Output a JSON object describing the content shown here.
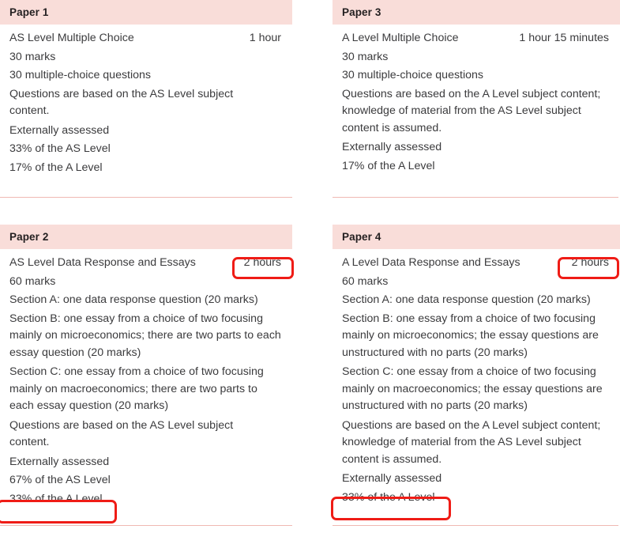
{
  "theme": {
    "header_band": "#f9ddd9",
    "rule_color": "#f0b9b3",
    "text_color": "#3b3b3d",
    "highlight_color": "#ef1c16"
  },
  "papers": [
    {
      "id": "paper-1",
      "header": "Paper 1",
      "title": "AS Level Multiple Choice",
      "duration": "1 hour",
      "lines": [
        "30 marks",
        "30 multiple-choice questions",
        "Questions are based on the AS Level subject content.",
        "Externally assessed",
        "33% of the AS Level",
        "17% of the A Level"
      ]
    },
    {
      "id": "paper-3",
      "header": "Paper 3",
      "title": "A Level Multiple Choice",
      "duration": "1 hour 15 minutes",
      "lines": [
        "30 marks",
        "30 multiple-choice questions",
        "Questions are based on the A Level subject content; knowledge of material from the AS Level subject content is assumed.",
        "Externally assessed",
        "17% of the A Level"
      ]
    },
    {
      "id": "paper-2",
      "header": "Paper 2",
      "title": "AS Level Data Response and Essays",
      "duration": "2 hours",
      "lines": [
        "60 marks",
        "Section A: one data response question (20 marks)",
        "Section B: one essay from a choice of two focusing mainly on microeconomics; there are two parts to each essay question (20 marks)",
        "Section C: one essay from a choice of two focusing mainly on macroeconomics; there are two parts to each essay question (20 marks)",
        "Questions are based on the AS Level subject content.",
        "Externally assessed",
        "67% of the AS Level",
        "33% of the A Level"
      ]
    },
    {
      "id": "paper-4",
      "header": "Paper 4",
      "title": "A Level Data Response and Essays",
      "duration": "2 hours",
      "lines": [
        "60 marks",
        "Section A: one data response question (20 marks)",
        "Section B: one essay from a choice of two focusing mainly on microeconomics; the essay questions are unstructured with no parts (20 marks)",
        "Section C: one essay from a choice of two focusing mainly on macroeconomics; the essay questions are unstructured with no parts (20 marks)",
        "Questions are based on the A Level subject content; knowledge of material from the AS Level subject content is assumed.",
        "Externally assessed",
        "33% of the A Level"
      ]
    }
  ],
  "annotations": [
    {
      "id": "hl-paper2-duration",
      "label": "2 hours",
      "target": "paper-2 duration"
    },
    {
      "id": "hl-paper4-duration",
      "label": "2 hours",
      "target": "paper-4 duration"
    },
    {
      "id": "hl-paper2-alevel",
      "label": "33% of the A Level",
      "target": "paper-2 last line"
    },
    {
      "id": "hl-paper4-alevel",
      "label": "33% of the A Level",
      "target": "paper-4 last line"
    }
  ]
}
